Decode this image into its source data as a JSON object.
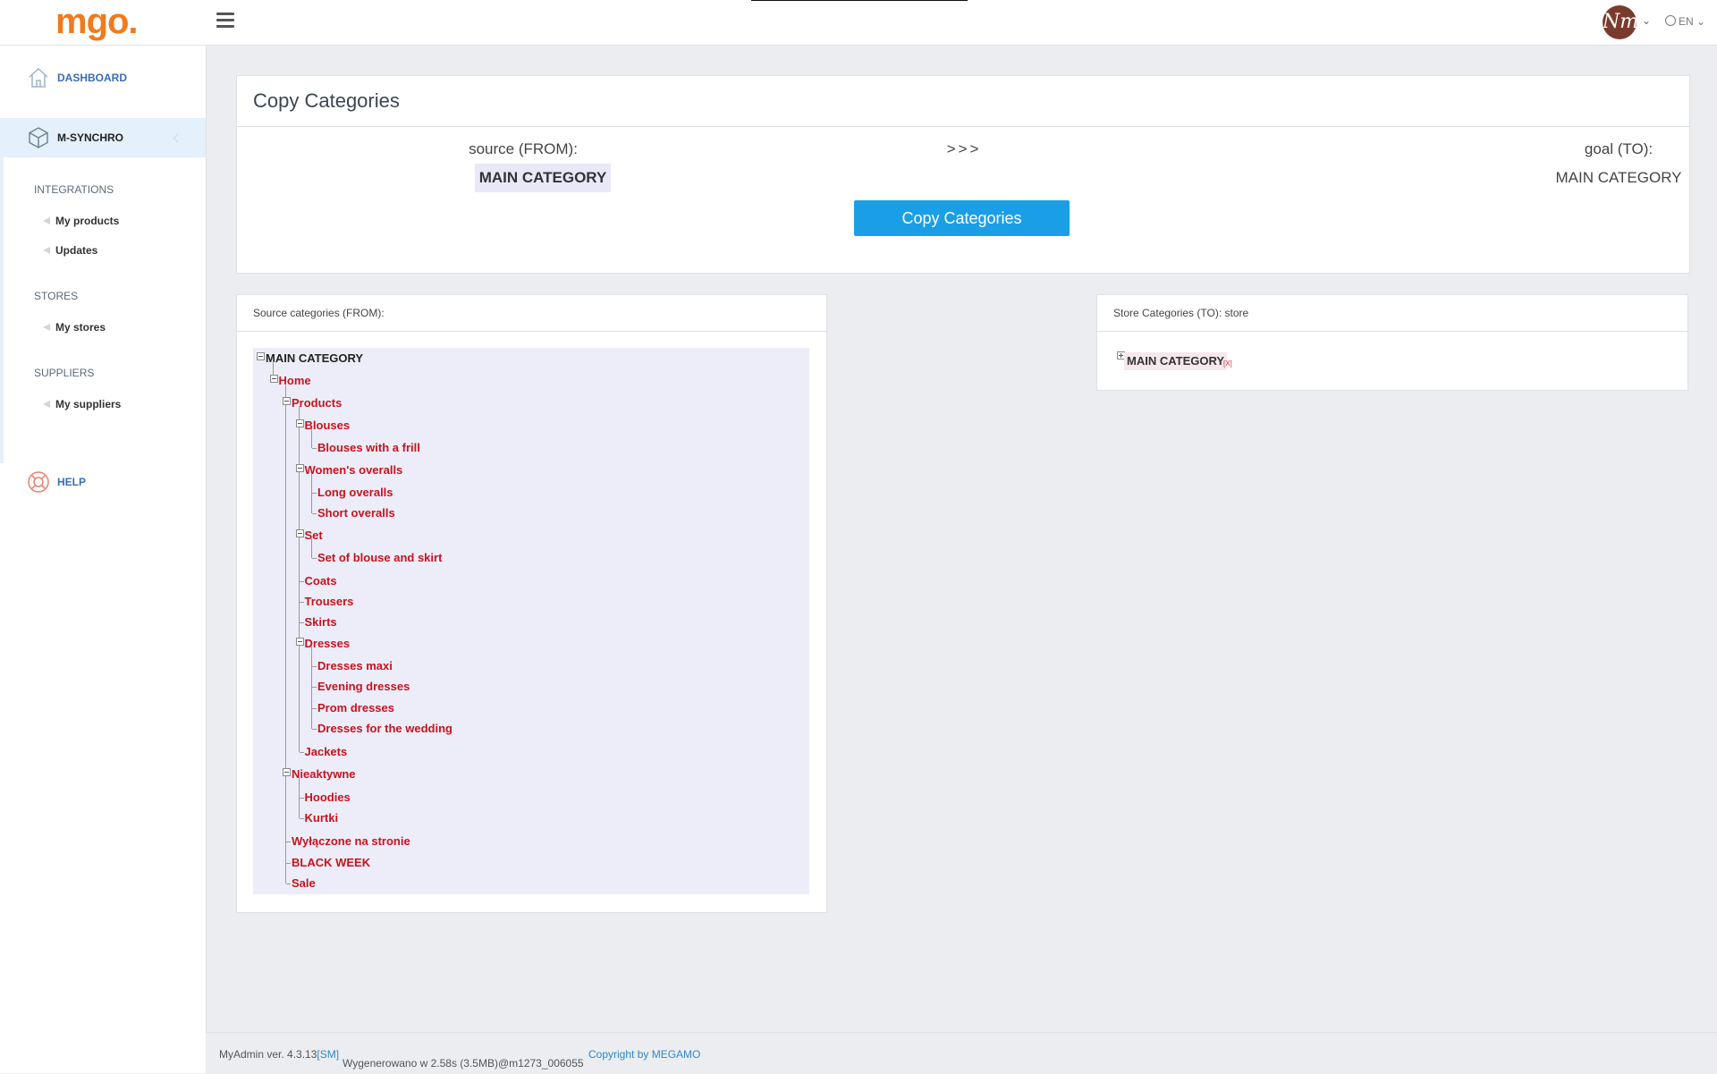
{
  "header": {
    "logo": "mgo.",
    "avatar_initials": "Nm",
    "language": "EN"
  },
  "sidebar": {
    "dashboard": "DASHBOARD",
    "msynchro": "M-SYNCHRO",
    "sections": [
      {
        "title": "INTEGRATIONS",
        "items": [
          "My products",
          "Updates"
        ]
      },
      {
        "title": "STORES",
        "items": [
          "My stores"
        ]
      },
      {
        "title": "SUPPLIERS",
        "items": [
          "My suppliers"
        ]
      }
    ],
    "help": "HELP"
  },
  "copy_panel": {
    "title": "Copy Categories",
    "source_label": "source (FROM):",
    "source_value": "MAIN CATEGORY",
    "arrows": ">>>",
    "goal_label": "goal (TO):",
    "goal_value": "MAIN CATEGORY",
    "button": "Copy Categories"
  },
  "source_panel": {
    "title": "Source categories (FROM):",
    "tree": [
      {
        "label": "MAIN CATEGORY",
        "level": 0,
        "toggle": true
      },
      {
        "label": "Home",
        "level": 1,
        "toggle": true
      },
      {
        "label": "Products",
        "level": 2,
        "toggle": true
      },
      {
        "label": "Blouses",
        "level": 3,
        "toggle": true
      },
      {
        "label": "Blouses with a frill",
        "level": 4
      },
      {
        "label": "Women's overalls",
        "level": 3,
        "toggle": true
      },
      {
        "label": "Long overalls",
        "level": 4
      },
      {
        "label": "Short overalls",
        "level": 4
      },
      {
        "label": "Set",
        "level": 3,
        "toggle": true
      },
      {
        "label": "Set of blouse and skirt",
        "level": 4
      },
      {
        "label": "Coats",
        "level": 3
      },
      {
        "label": "Trousers",
        "level": 3
      },
      {
        "label": "Skirts",
        "level": 3
      },
      {
        "label": "Dresses",
        "level": 3,
        "toggle": true
      },
      {
        "label": "Dresses maxi",
        "level": 4
      },
      {
        "label": "Evening dresses",
        "level": 4
      },
      {
        "label": "Prom dresses",
        "level": 4
      },
      {
        "label": "Dresses for the wedding",
        "level": 4
      },
      {
        "label": "Jackets",
        "level": 3
      },
      {
        "label": "Nieaktywne",
        "level": 2,
        "toggle": true
      },
      {
        "label": "Hoodies",
        "level": 3
      },
      {
        "label": "Kurtki",
        "level": 3
      },
      {
        "label": "Wyłączone na stronie",
        "level": 2
      },
      {
        "label": "BLACK WEEK",
        "level": 2
      },
      {
        "label": "Sale",
        "level": 2
      }
    ]
  },
  "store_panel": {
    "title": "Store Categories (TO): store",
    "root": "MAIN CATEGORY",
    "remove": "[X]"
  },
  "footer": {
    "version": "MyAdmin ver. 4.3.13",
    "sm": "[SM]",
    "generated": "Wygenerowano w 2.58s (3.5MB)@m1273_006055",
    "copyright": "Copyright by MEGAMO"
  }
}
